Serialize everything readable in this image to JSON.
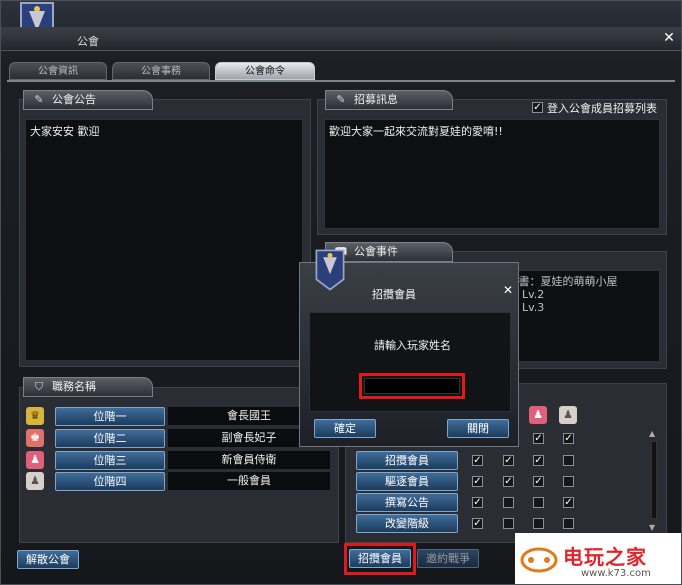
{
  "window": {
    "title": "公會",
    "close_label": "✕"
  },
  "tabs": [
    {
      "label": "公會資訊",
      "active": false
    },
    {
      "label": "公會事務",
      "active": false
    },
    {
      "label": "公會命令",
      "active": true
    }
  ],
  "announcement": {
    "header": "公會公告",
    "text": "大家安安 歡迎"
  },
  "recruit": {
    "header": "招募訊息",
    "checkbox_label": "登入公會成員招募列表",
    "checked": true,
    "text": "歡迎大家一起來交流對夏娃的愛唷!!"
  },
  "events": {
    "header": "公會事件",
    "lines": [
      "2013 年 7 月 23 日：超級使者副交易書：夏娃的萌萌小屋",
      "2013 年 7 月 23 日：公會等級提升為 Lv.2",
      "2013 年 7 月 23 日：公會等級提升為 Lv.3"
    ]
  },
  "ranks": {
    "header": "職務名稱",
    "items": [
      {
        "button": "位階一",
        "name": "會長國王",
        "icon": "crown-icon",
        "color": "#d9b43a"
      },
      {
        "button": "位階二",
        "name": "副會長妃子",
        "icon": "rank2-icon",
        "color": "#e0706a"
      },
      {
        "button": "位階三",
        "name": "新會員侍衛",
        "icon": "rank3-icon",
        "color": "#e0607c"
      },
      {
        "button": "位階四",
        "name": "一般會員",
        "icon": "rank4-icon",
        "color": "#d8d0c8"
      }
    ]
  },
  "permissions": {
    "rows": [
      {
        "label": "招攬會員",
        "checks": [
          true,
          true,
          true,
          false
        ]
      },
      {
        "label": "驅逐會員",
        "checks": [
          true,
          true,
          true,
          false
        ]
      },
      {
        "label": "撰寫公告",
        "checks": [
          true,
          false,
          false,
          true
        ]
      },
      {
        "label": "改變階級",
        "checks": [
          true,
          false,
          false,
          false
        ]
      }
    ],
    "top_checks": [
      true,
      true,
      true
    ]
  },
  "bottom": {
    "disband_label": "解散公會",
    "recruit_label": "招攬會員",
    "dim_label": "邀約戰爭"
  },
  "dialog": {
    "title": "招攬會員",
    "prompt": "請輸入玩家姓名",
    "input_value": "",
    "confirm_label": "確定",
    "close_label": "關閉"
  },
  "watermark": {
    "brand": "电玩之家",
    "url": "www.k73.com"
  },
  "colors": {
    "highlight": "#e01a1a",
    "button": "#2c5580"
  }
}
